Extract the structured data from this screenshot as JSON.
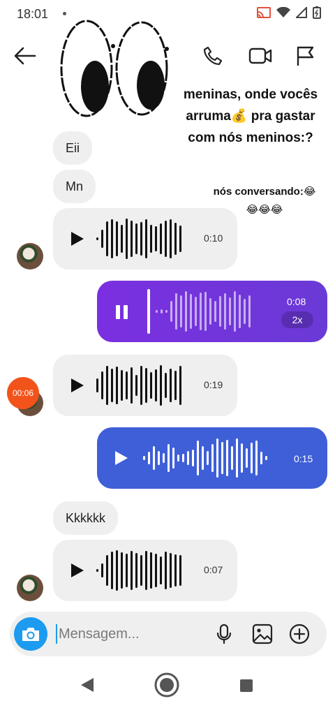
{
  "status": {
    "time": "18:01"
  },
  "header": {
    "back_icon": "arrow-left-icon",
    "call_icon": "phone-icon",
    "video_icon": "video-camera-icon",
    "report_icon": "flag-icon"
  },
  "sticker": {
    "icon": "cartoon-eyes-sticker"
  },
  "captions": {
    "line1": "meninas, onde vocês",
    "line2": "arruma💰 pra gastar",
    "line3": "com nós meninos:?",
    "sub1": "nós conversando:😂",
    "sub2": "😂😂😂"
  },
  "messages": {
    "m1": "Eii",
    "m2": "Mn",
    "a1_duration": "0:10",
    "a2_duration": "0:08",
    "a2_speed": "2x",
    "a3_duration": "0:19",
    "timer_badge": "00:06",
    "a4_duration": "0:15",
    "m3": "Kkkkkk",
    "a5_duration": "0:07"
  },
  "composer": {
    "placeholder": "Mensagem..."
  },
  "colors": {
    "incoming_bubble": "#efefef",
    "outgoing_purple": "#7b2fe0",
    "outgoing_blue": "#3e5fd8",
    "camera_button": "#1d9bf0",
    "timer_badge": "#f2531b"
  }
}
